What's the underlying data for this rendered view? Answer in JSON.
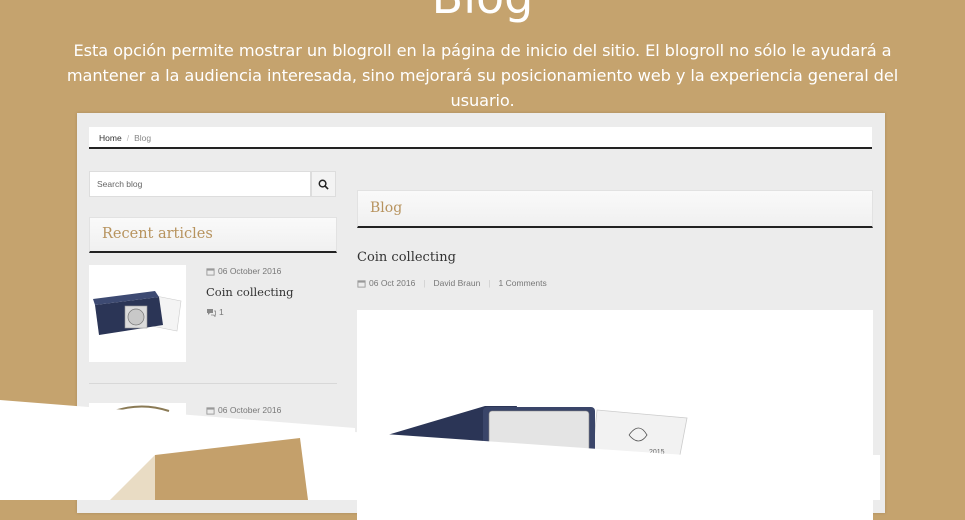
{
  "hero": {
    "title": "Blog",
    "description": "Esta opción permite mostrar un blogroll en la página de inicio del sitio. El blogroll no sólo le ayudará a mantener a la audiencia interesada, sino mejorará su posicionamiento web y la experiencia general del usuario."
  },
  "breadcrumb": {
    "home": "Home",
    "separator": "/",
    "current": "Blog"
  },
  "search": {
    "placeholder": "Search blog",
    "icon": "search-icon"
  },
  "sidebar": {
    "recent_title": "Recent articles",
    "articles": [
      {
        "date": "06 October 2016",
        "title": "Coin collecting",
        "comments": "1"
      },
      {
        "date": "06 October 2016"
      }
    ]
  },
  "main": {
    "heading": "Blog",
    "post": {
      "title": "Coin collecting",
      "date": "06 Oct 2016",
      "author": "David Braun",
      "comments": "1 Comments"
    },
    "certificate_text": "2015"
  },
  "colors": {
    "background": "#c5a36e",
    "accent": "#b7935e",
    "dark": "#222222"
  }
}
